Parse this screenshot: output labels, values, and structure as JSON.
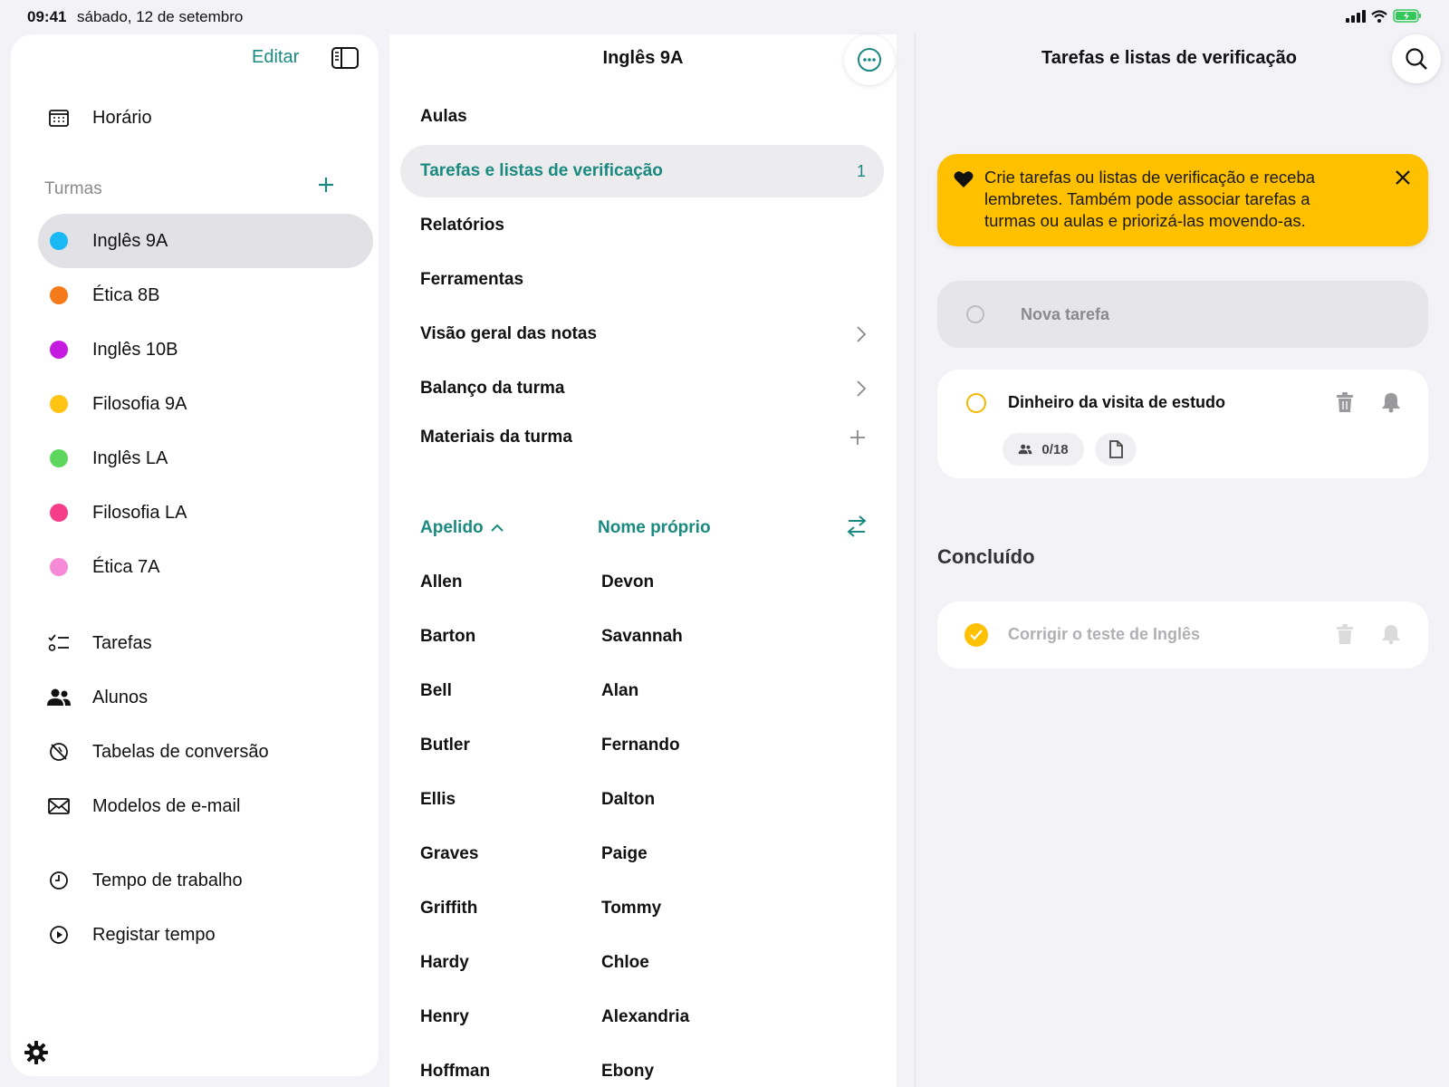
{
  "status": {
    "time": "09:41",
    "date": "sábado, 12 de setembro"
  },
  "sidebar": {
    "edit_label": "Editar",
    "schedule": "Horário",
    "section_title": "Turmas",
    "classes": [
      {
        "label": "Inglês 9A",
        "color": "#1ab8f5"
      },
      {
        "label": "Ética 8B",
        "color": "#f57a1a"
      },
      {
        "label": "Inglês 10B",
        "color": "#c51ae0"
      },
      {
        "label": "Filosofia 9A",
        "color": "#ffc414"
      },
      {
        "label": "Inglês LA",
        "color": "#5cd65c"
      },
      {
        "label": "Filosofia LA",
        "color": "#f53d8a"
      },
      {
        "label": "Ética 7A",
        "color": "#f78ad6"
      }
    ],
    "nav": [
      "Tarefas",
      "Alunos",
      "Tabelas de conversão",
      "Modelos de e-mail"
    ],
    "time": [
      "Tempo de trabalho",
      "Registar tempo"
    ]
  },
  "middle": {
    "title": "Inglês 9A",
    "rows": [
      {
        "label": "Aulas"
      },
      {
        "label": "Tarefas e listas de verificação",
        "badge": "1"
      },
      {
        "label": "Relatórios"
      },
      {
        "label": "Ferramentas"
      },
      {
        "label": "Visão geral das notas"
      },
      {
        "label": "Balanço da turma"
      },
      {
        "label": "Materiais da turma"
      }
    ],
    "sort_last": "Apelido",
    "sort_first": "Nome próprio",
    "students": [
      [
        "Allen",
        "Devon"
      ],
      [
        "Barton",
        "Savannah"
      ],
      [
        "Bell",
        "Alan"
      ],
      [
        "Butler",
        "Fernando"
      ],
      [
        "Ellis",
        "Dalton"
      ],
      [
        "Graves",
        "Paige"
      ],
      [
        "Griffith",
        "Tommy"
      ],
      [
        "Hardy",
        "Chloe"
      ],
      [
        "Henry",
        "Alexandria"
      ],
      [
        "Hoffman",
        "Ebony"
      ]
    ]
  },
  "right": {
    "title": "Tarefas e listas de verificação",
    "banner": "Crie tarefas ou listas de verificação e receba lembretes. Também pode associar tarefas a turmas ou aulas e priorizá-las movendo-as.",
    "new_task_placeholder": "Nova tarefa",
    "task": {
      "title": "Dinheiro da visita de estudo",
      "students": "0/18"
    },
    "done_title": "Concluído",
    "done_task": "Corrigir o teste de Inglês"
  },
  "colors": {
    "accent": "#1a8a80",
    "banner": "#ffc000"
  }
}
